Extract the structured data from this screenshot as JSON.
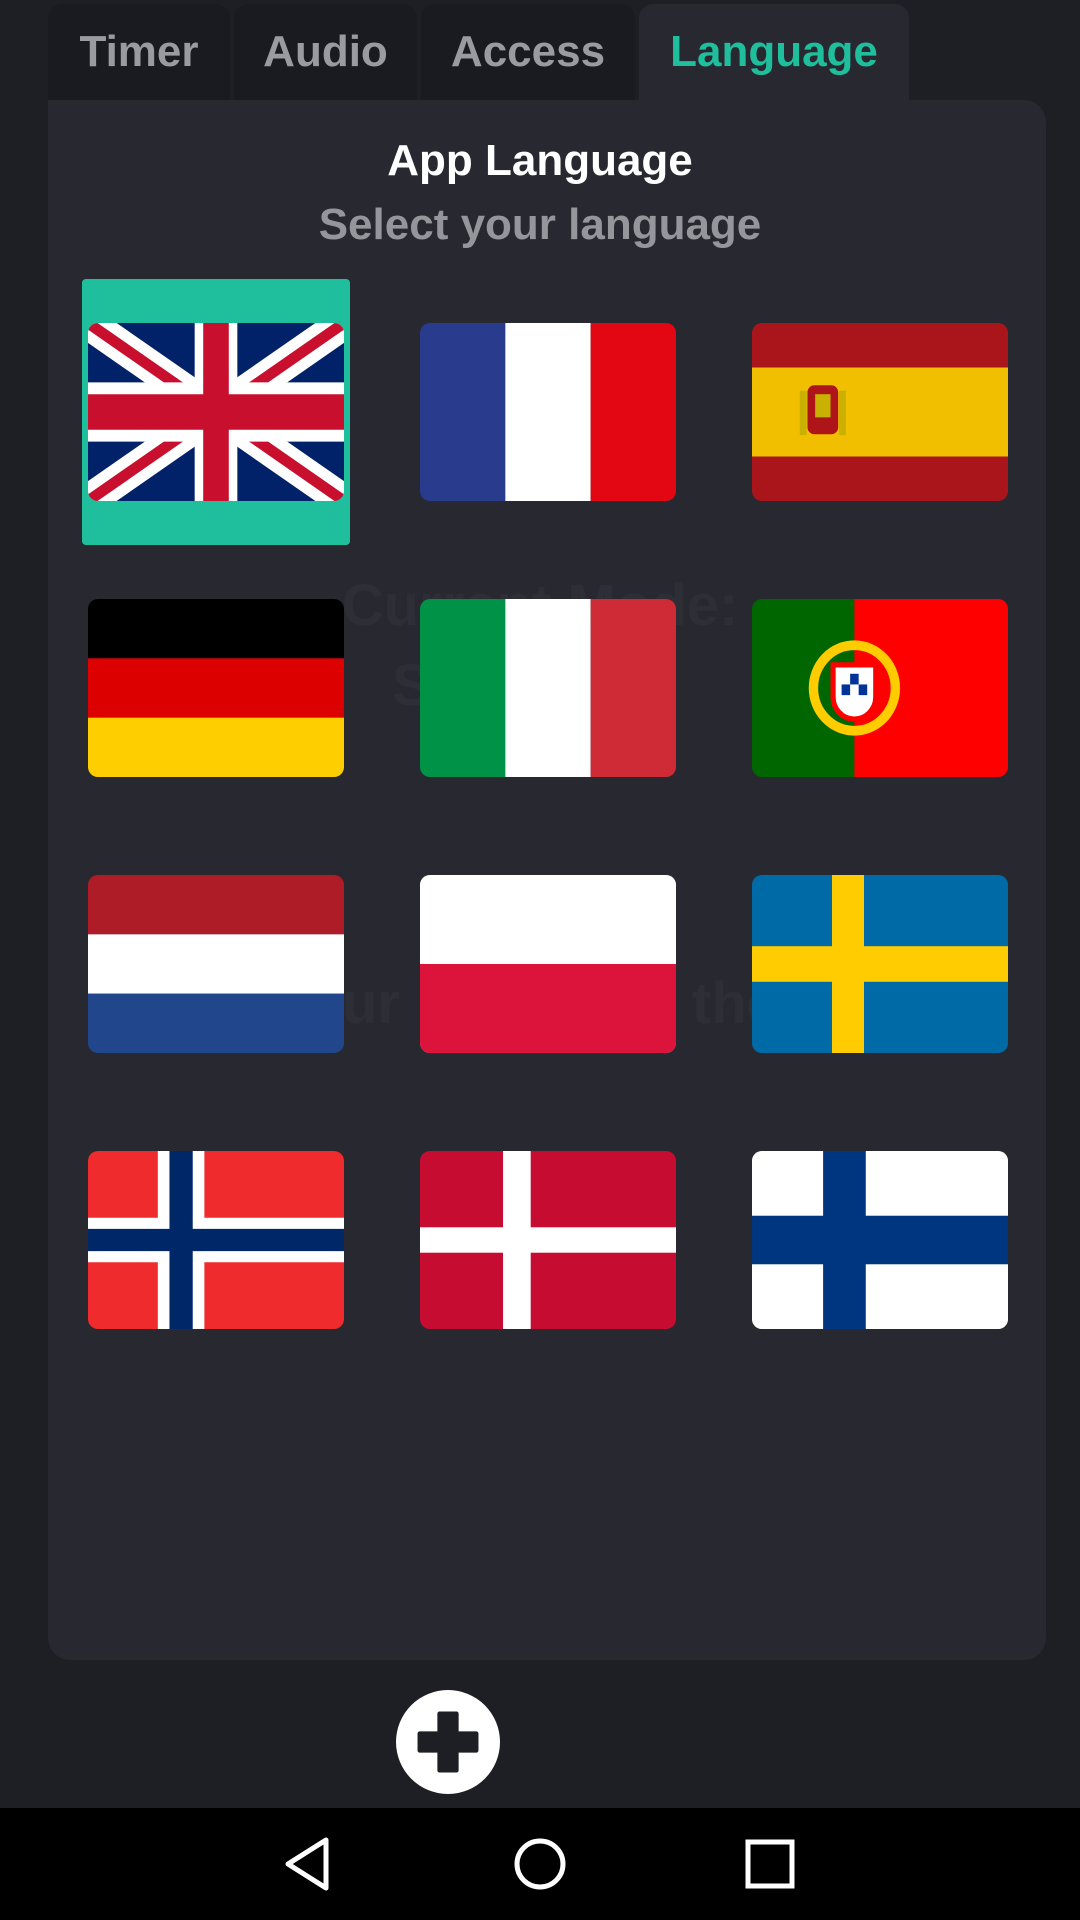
{
  "tabs": [
    {
      "label": "Timer"
    },
    {
      "label": "Audio"
    },
    {
      "label": "Access"
    },
    {
      "label": "Language"
    }
  ],
  "active_tab": "Language",
  "panel": {
    "title": "App Language",
    "subtitle": "Select your language",
    "background_ghost_text": [
      "Current Mode:",
      "S",
      "ur",
      "the"
    ]
  },
  "languages": [
    {
      "flag": "united-kingdom-flag",
      "selected": true
    },
    {
      "flag": "france-flag",
      "selected": false
    },
    {
      "flag": "spain-flag",
      "selected": false
    },
    {
      "flag": "germany-flag",
      "selected": false
    },
    {
      "flag": "italy-flag",
      "selected": false
    },
    {
      "flag": "portugal-flag",
      "selected": false
    },
    {
      "flag": "netherlands-flag",
      "selected": false
    },
    {
      "flag": "poland-flag",
      "selected": false
    },
    {
      "flag": "sweden-flag",
      "selected": false
    },
    {
      "flag": "norway-flag",
      "selected": false
    },
    {
      "flag": "denmark-flag",
      "selected": false
    },
    {
      "flag": "finland-flag",
      "selected": false
    }
  ],
  "fab": {
    "icon": "plus-icon"
  },
  "navbar": {
    "buttons": [
      "back-icon",
      "home-icon",
      "recents-icon"
    ]
  },
  "colors": {
    "accent": "#1fbf9e",
    "background": "#1e1f25",
    "panel": "#282930",
    "tab_inactive_text": "#9a9ba0"
  }
}
